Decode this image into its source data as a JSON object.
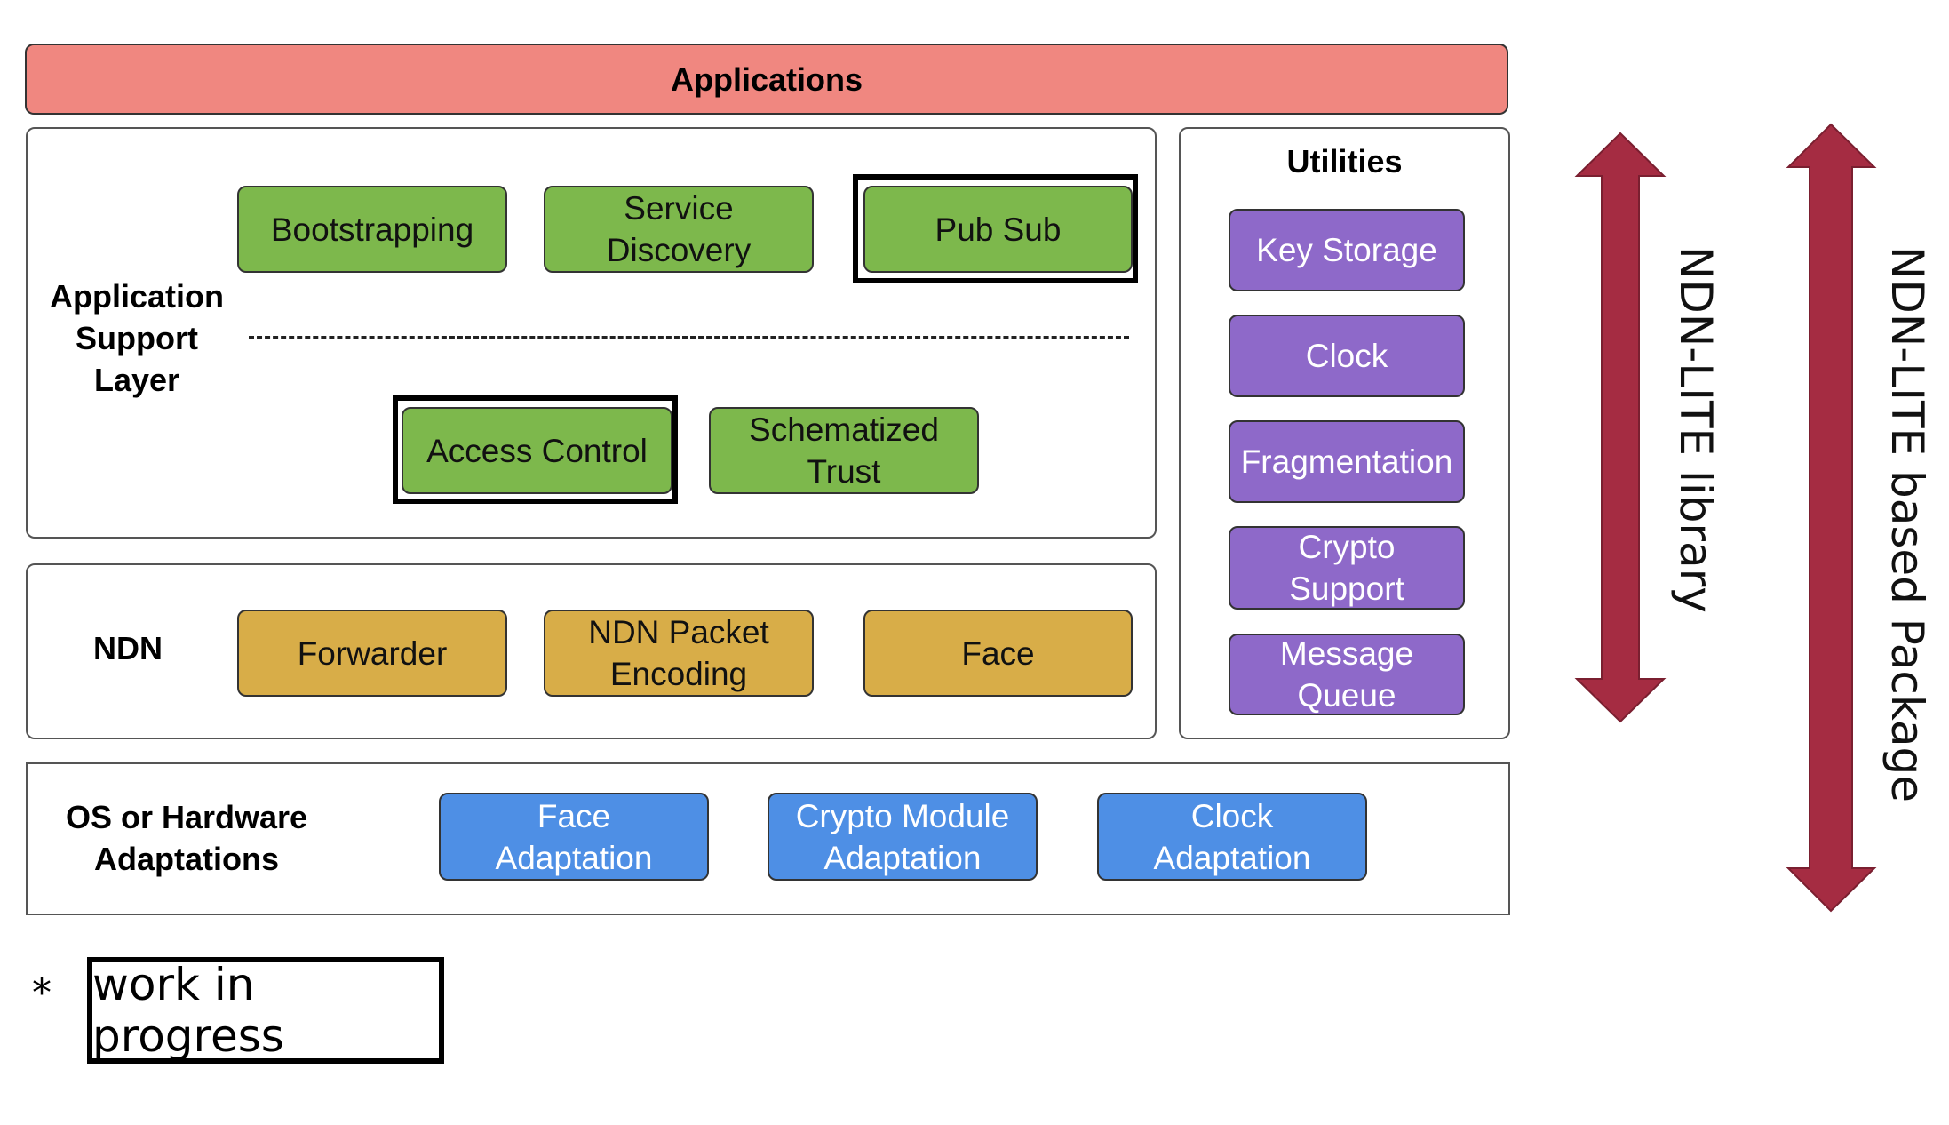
{
  "applications": {
    "label": "Applications",
    "color": "#f08780"
  },
  "app_support": {
    "label": "Application\nSupport\nLayer",
    "modules": [
      {
        "label": "Bootstrapping",
        "wip": false
      },
      {
        "label": "Service\nDiscovery",
        "wip": false
      },
      {
        "label": "Pub Sub",
        "wip": true
      },
      {
        "label": "Access Control",
        "wip": true
      },
      {
        "label": "Schematized\nTrust",
        "wip": false
      }
    ],
    "color": "#7db84c"
  },
  "ndn": {
    "label": "NDN",
    "modules": [
      {
        "label": "Forwarder"
      },
      {
        "label": "NDN Packet\nEncoding"
      },
      {
        "label": "Face"
      }
    ],
    "color": "#d8ad48"
  },
  "utilities": {
    "label": "Utilities",
    "modules": [
      {
        "label": "Key Storage"
      },
      {
        "label": "Clock"
      },
      {
        "label": "Fragmentation"
      },
      {
        "label": "Crypto\nSupport"
      },
      {
        "label": "Message\nQueue"
      }
    ],
    "color": "#8e69c9"
  },
  "os": {
    "label": "OS or Hardware\nAdaptations",
    "modules": [
      {
        "label": "Face\nAdaptation"
      },
      {
        "label": "Crypto Module\nAdaptation"
      },
      {
        "label": "Clock\nAdaptation"
      }
    ],
    "color": "#4e8fe5"
  },
  "scopes": [
    {
      "label": "NDN-LITE library",
      "icon": "double-arrow-icon"
    },
    {
      "label": "NDN-LITE based Package",
      "icon": "double-arrow-icon"
    }
  ],
  "arrow_color": "#a52c42",
  "legend": {
    "marker": "*",
    "label": "work in progress"
  }
}
